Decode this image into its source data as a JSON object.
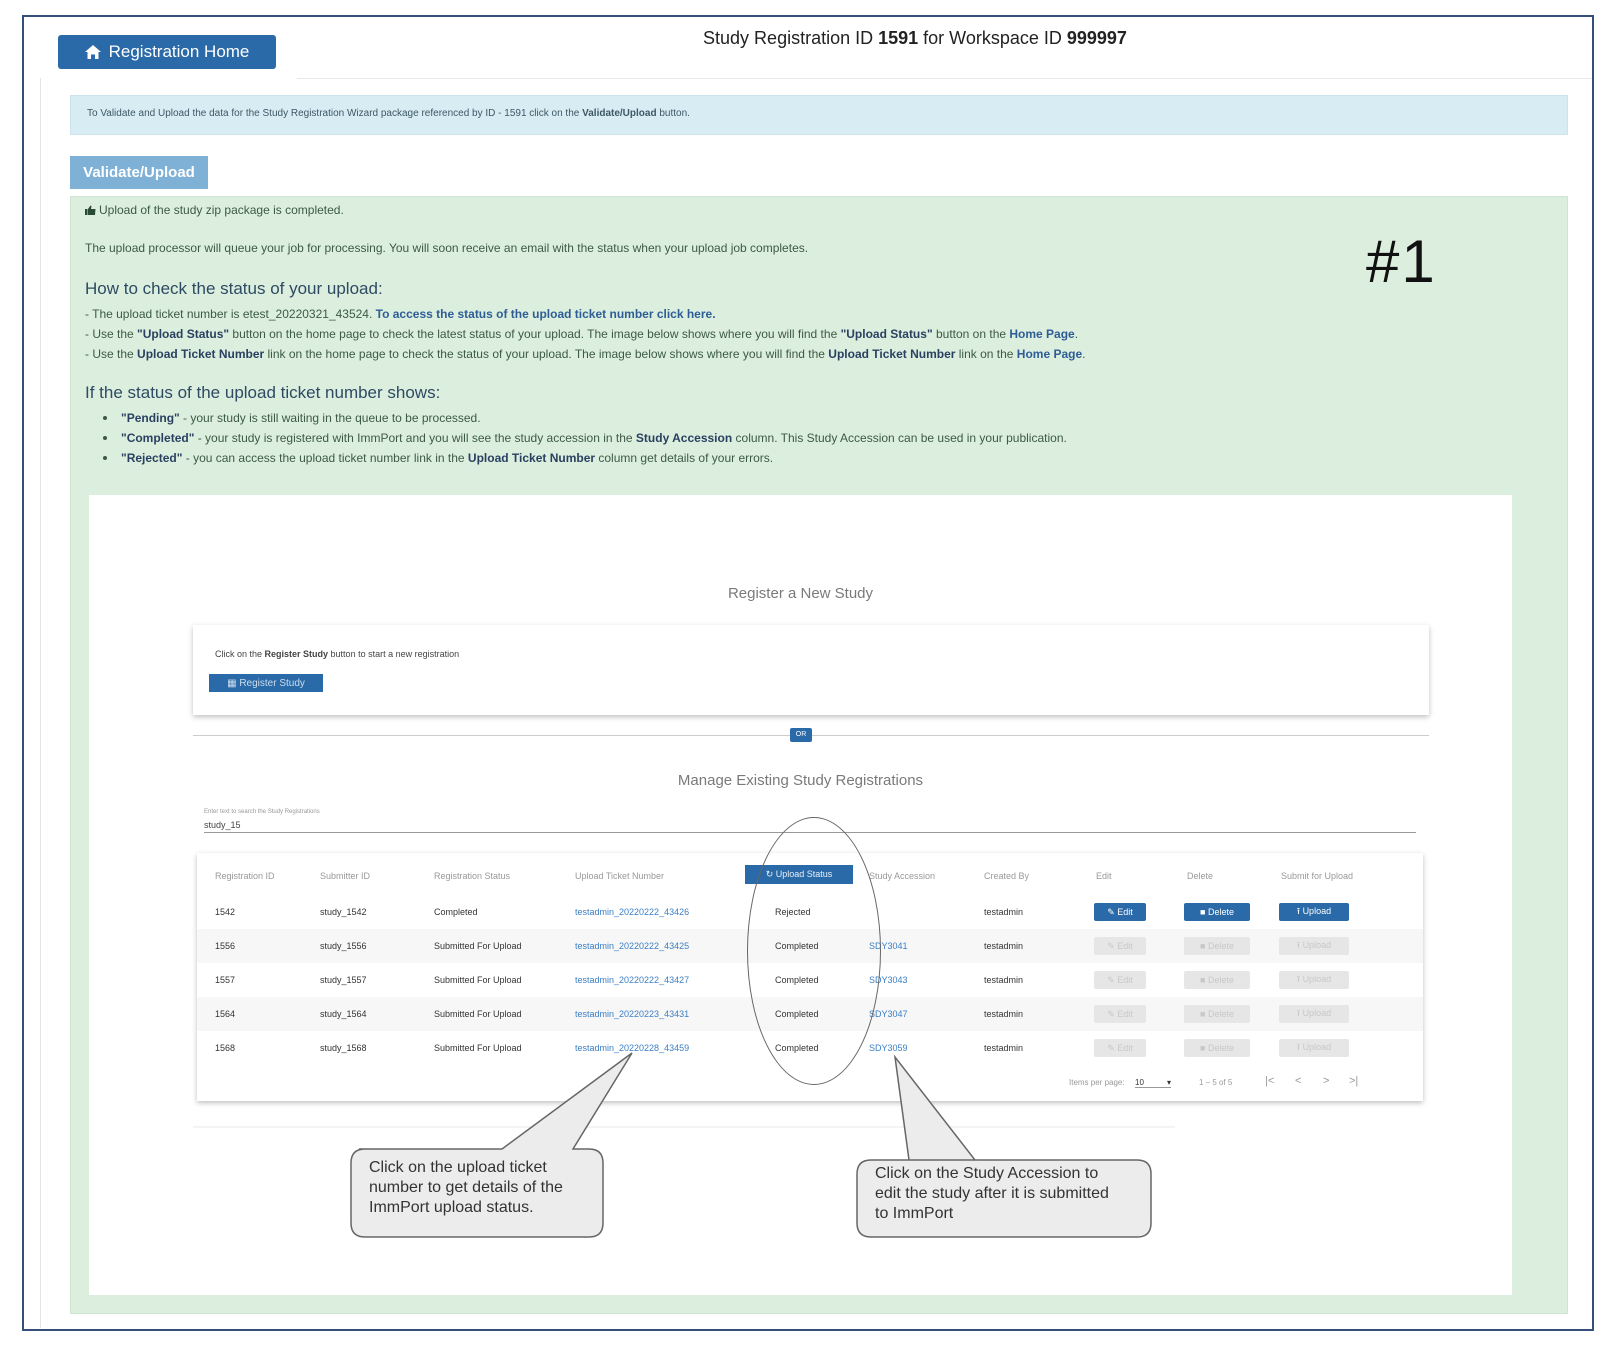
{
  "header": {
    "home_button": "Registration Home",
    "title_prefix": "Study Registration ID ",
    "registration_id": "1591",
    "title_middle": " for Workspace ID ",
    "workspace_id": "999997"
  },
  "info_bar": {
    "text_before": "To Validate and Upload the data for the Study Registration Wizard package referenced by ID - 1591 click on the ",
    "text_bold": "Validate/Upload",
    "text_after": " button."
  },
  "validate_button": "Validate/Upload",
  "success_panel": {
    "completed_msg": "Upload of the study zip package is completed.",
    "queue_msg": "The upload processor will queue your job for processing. You will soon receive an email with the status when your upload job completes.",
    "marker": "#1",
    "how_heading": "How to check the status of your upload:",
    "how_lines": [
      {
        "pre": "- The upload ticket number is etest_20220321_43524. ",
        "link": "To access the status of the upload ticket number click here.",
        "post": ""
      },
      {
        "pre": "- Use the ",
        "b1": "\"Upload Status\"",
        "mid": " button on the home page to check the latest status of your upload. The image below shows where you will find the ",
        "b2": "\"Upload Status\"",
        "mid2": " button on the ",
        "link": "Home Page",
        "post": "."
      },
      {
        "pre": "- Use the ",
        "b1": "Upload Ticket Number",
        "mid": " link on the home page to check the status of your upload. The image below shows where you will find the ",
        "b2": "Upload Ticket Number",
        "mid2": " link on the ",
        "link": "Home Page",
        "post": "."
      }
    ],
    "status_heading": "If the status of the upload ticket number shows:",
    "status_lines": [
      {
        "b": "\"Pending\"",
        "text": " - your study is still waiting in the queue to be processed."
      },
      {
        "b": "\"Completed\"",
        "text": " - your study is registered with ImmPort and you will see the study accession in the ",
        "b2": "Study Accession",
        "text2": " column. This Study Accession can be used in your publication."
      },
      {
        "b": "\"Rejected\"",
        "text": " - you can access the upload ticket number link in the ",
        "b2": "Upload Ticket Number",
        "text2": " column get details of your errors."
      }
    ]
  },
  "screenshot": {
    "register_title": "Register a New Study",
    "register_text_pre": "Click on the ",
    "register_text_b": "Register Study",
    "register_text_post": " button to start a new registration",
    "register_button": "Register Study",
    "or_badge": "OR",
    "manage_title": "Manage Existing Study Registrations",
    "search_label": "Enter text to search the Study Registrations",
    "search_value": "study_15",
    "columns": [
      "Registration ID",
      "Submitter ID",
      "Registration Status",
      "Upload Ticket Number",
      "Upload Status",
      "Study Accession",
      "Created By",
      "Edit",
      "Delete",
      "Submit for Upload"
    ],
    "rows": [
      {
        "id": "1542",
        "submitter": "study_1542",
        "status": "Completed",
        "ticket": "testadmin_20220222_43426",
        "upload_status": "Rejected",
        "accession": "",
        "created_by": "testadmin",
        "enabled": true
      },
      {
        "id": "1556",
        "submitter": "study_1556",
        "status": "Submitted For Upload",
        "ticket": "testadmin_20220222_43425",
        "upload_status": "Completed",
        "accession": "SDY3041",
        "created_by": "testadmin",
        "enabled": false
      },
      {
        "id": "1557",
        "submitter": "study_1557",
        "status": "Submitted For Upload",
        "ticket": "testadmin_20220222_43427",
        "upload_status": "Completed",
        "accession": "SDY3043",
        "created_by": "testadmin",
        "enabled": false
      },
      {
        "id": "1564",
        "submitter": "study_1564",
        "status": "Submitted For Upload",
        "ticket": "testadmin_20220223_43431",
        "upload_status": "Completed",
        "accession": "SDY3047",
        "created_by": "testadmin",
        "enabled": false
      },
      {
        "id": "1568",
        "submitter": "study_1568",
        "status": "Submitted For Upload",
        "ticket": "testadmin_20220228_43459",
        "upload_status": "Completed",
        "accession": "SDY3059",
        "created_by": "testadmin",
        "enabled": false
      }
    ],
    "action_labels": {
      "edit": "Edit",
      "delete": "Delete",
      "upload": "Upload"
    },
    "pager": {
      "items_label": "Items per page:",
      "items_value": "10",
      "range": "1 – 5 of 5"
    },
    "callout_left": [
      "Click on the upload ticket",
      "number to get details of the",
      "ImmPort upload status."
    ],
    "callout_right": [
      "Click on the Study Accession to",
      "edit the study after it is submitted",
      "to ImmPort"
    ]
  }
}
